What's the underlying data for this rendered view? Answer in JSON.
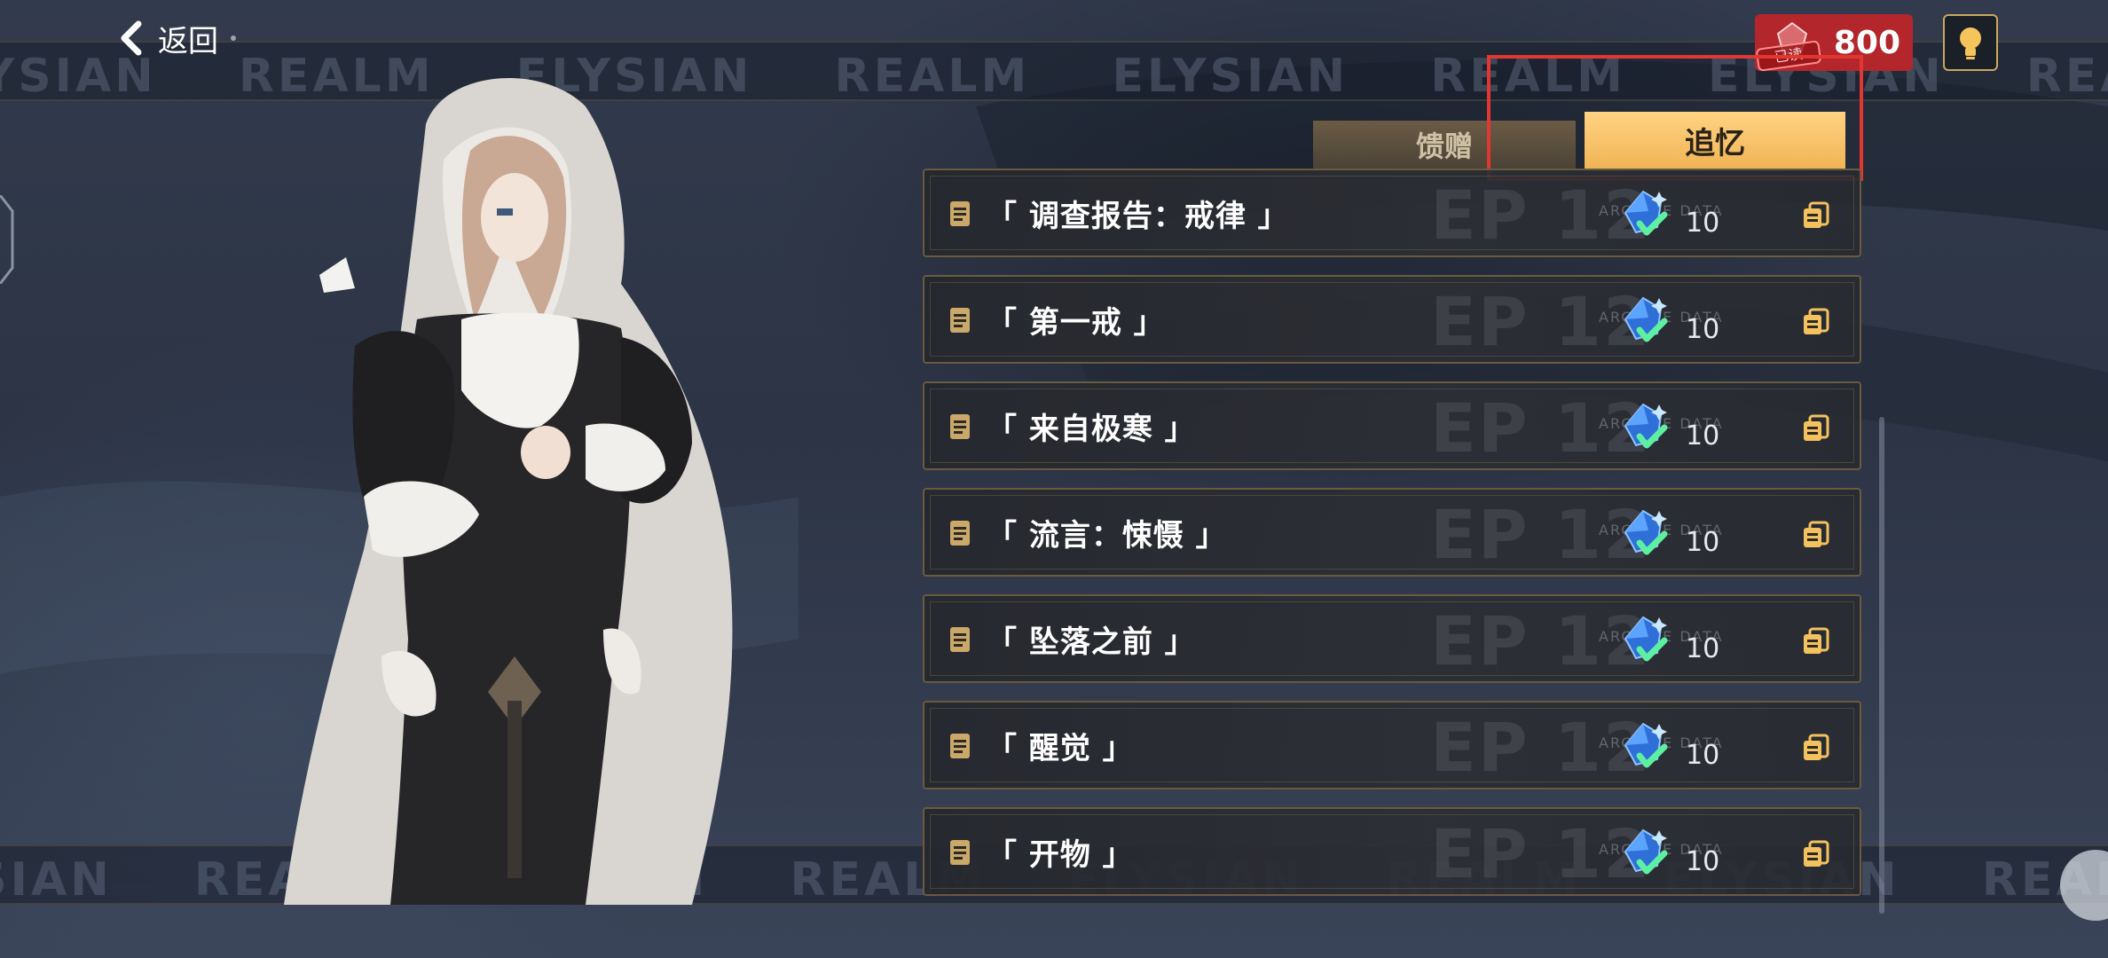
{
  "header": {
    "back_label": "返回",
    "currency_amount": "800",
    "currency_stamp": "已读"
  },
  "banner": {
    "text": "ELYSIAN REALM ELYSIAN REALM ELYSIAN REALM ELYSIAN REALM ELYSIAN REALM ELYSIAN REALM"
  },
  "tabs": [
    {
      "label": "馈赠",
      "active": false
    },
    {
      "label": "追忆",
      "active": true
    }
  ],
  "memories": [
    {
      "title": "「 调查报告：戒律 」",
      "episode": "EP 12",
      "stamp": "ARCHIVE DATA",
      "reward": "10",
      "claimed": true
    },
    {
      "title": "「 第一戒 」",
      "episode": "EP 12",
      "stamp": "ARCHIVE DATA",
      "reward": "10",
      "claimed": true
    },
    {
      "title": "「 来自极寒 」",
      "episode": "EP 12",
      "stamp": "ARCHIVE DATA",
      "reward": "10",
      "claimed": true
    },
    {
      "title": "「 流言：悚慑 」",
      "episode": "EP 12",
      "stamp": "ARCHIVE DATA",
      "reward": "10",
      "claimed": true
    },
    {
      "title": "「 坠落之前 」",
      "episode": "EP 12",
      "stamp": "ARCHIVE DATA",
      "reward": "10",
      "claimed": true
    },
    {
      "title": "「 醒觉 」",
      "episode": "EP 12",
      "stamp": "ARCHIVE DATA",
      "reward": "10",
      "claimed": true
    },
    {
      "title": "「 开物 」",
      "episode": "EP 12",
      "stamp": "ARCHIVE DATA",
      "reward": "10",
      "claimed": true
    }
  ],
  "colors": {
    "accent": "#f5c46a",
    "highlight": "#e23631",
    "currency_bg": "#b3262b"
  },
  "icons": {
    "doc": "document-icon",
    "reward": "crystal-icon",
    "claimed": "checkmark-icon",
    "copy": "copy-icon"
  }
}
